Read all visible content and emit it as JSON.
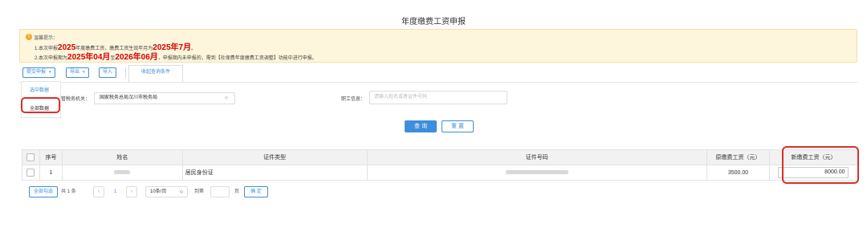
{
  "page_title": "年度缴费工资申报",
  "notice": {
    "title": "温馨提示：",
    "line1_prefix": "1.本次申报",
    "line1_year": "2025",
    "line1_mid": "年度缴费工资，缴费工资生效年月为",
    "line1_month": "2025年7月",
    "line1_suffix": "。",
    "line2_prefix": "2.本次申报期为",
    "line2_start": "2025年04月",
    "line2_to": "至",
    "line2_end": "2026年06月",
    "line2_suffix": "，申报期内未申报的，需到【社保费年度缴费工资调整】功能中进行申报。"
  },
  "toolbar": {
    "submit_label": "提交申报",
    "export_label": "导出",
    "import_label": "导入",
    "collapse_tab": "收起查询条件"
  },
  "dropdown": {
    "selected_data": "选中数据",
    "all_data": "全部数据"
  },
  "filters": {
    "tax_authority_label": "管税务机关：",
    "tax_authority_value": "国家税务总局汉川市税务局",
    "employee_label": "职工信息：",
    "employee_placeholder": "请输入姓名或者证件号码",
    "query_label": "查 询",
    "reset_label": "重 置"
  },
  "table": {
    "headers": [
      "序号",
      "姓名",
      "证件类型",
      "证件号码",
      "原缴费工资（元）",
      "新缴费工资（元）"
    ],
    "rows": [
      {
        "index": "1",
        "id_type": "居民身份证",
        "old_wage": "3500.00",
        "new_wage": "8000.00"
      }
    ]
  },
  "pagination": {
    "select_all": "全部勾选",
    "total_prefix": "共",
    "total_count": "1",
    "total_suffix": "条",
    "prev": "‹",
    "current_page": "1",
    "next": "›",
    "page_size": "10条/页",
    "goto_label": "到第",
    "page_unit": "页",
    "confirm": "确 定"
  },
  "colors": {
    "primary": "#3d8edc",
    "highlight": "#d9302a",
    "notice_bg": "#fdf6dc",
    "emphasis": "#d40000"
  }
}
